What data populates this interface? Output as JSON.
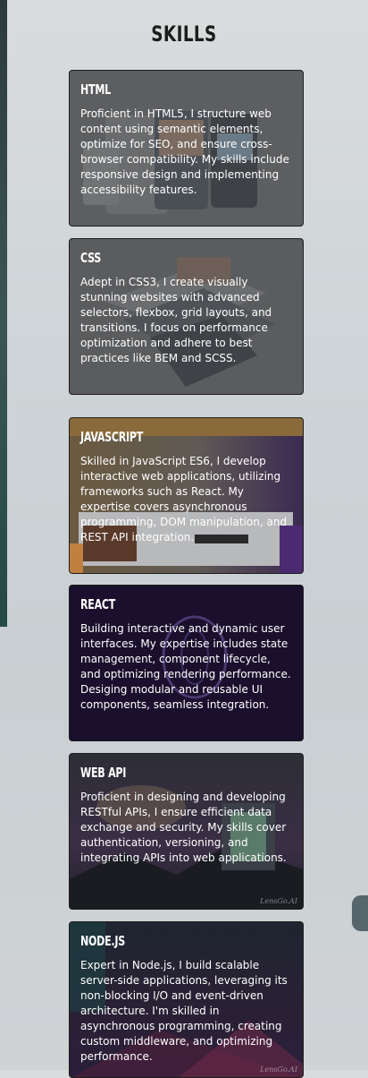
{
  "section": {
    "title": "SKILLS"
  },
  "skills": [
    {
      "title": "HTML",
      "description": "Proficient in HTML5, I structure web content using semantic elements, optimize for SEO, and ensure cross-browser compatibility. My skills include responsive design and implementing accessibility features."
    },
    {
      "title": "CSS",
      "description": "Adept in CSS3, I create visually stunning websites with advanced selectors, flexbox, grid layouts, and transitions. I focus on performance optimization and adhere to best practices like BEM and SCSS."
    },
    {
      "title": "JAVASCRIPT",
      "description": "Skilled in JavaScript ES6, I develop interactive web applications, utilizing frameworks such as React. My expertise covers asynchronous programming, DOM manipulation, and REST API integration."
    },
    {
      "title": "REACT",
      "description": "Building interactive and dynamic user interfaces. My expertise includes state management, component lifecycle, and optimizing rendering performance. Desiging modular and reusable UI components, seamless integration."
    },
    {
      "title": "WEB API",
      "description": "Proficient in designing and developing RESTful APIs, I ensure efficient data exchange and security. My skills cover authentication, versioning, and integrating APIs into web applications."
    },
    {
      "title": "NODE.JS",
      "description": "Expert in Node.js, I build scalable server-side applications, leveraging its non-blocking I/O and event-driven architecture. I'm skilled in asynchronous programming, creating custom middleware, and optimizing performance."
    }
  ],
  "watermarks": {
    "api": "LensGo.AI",
    "node": "LensGo.AI"
  }
}
